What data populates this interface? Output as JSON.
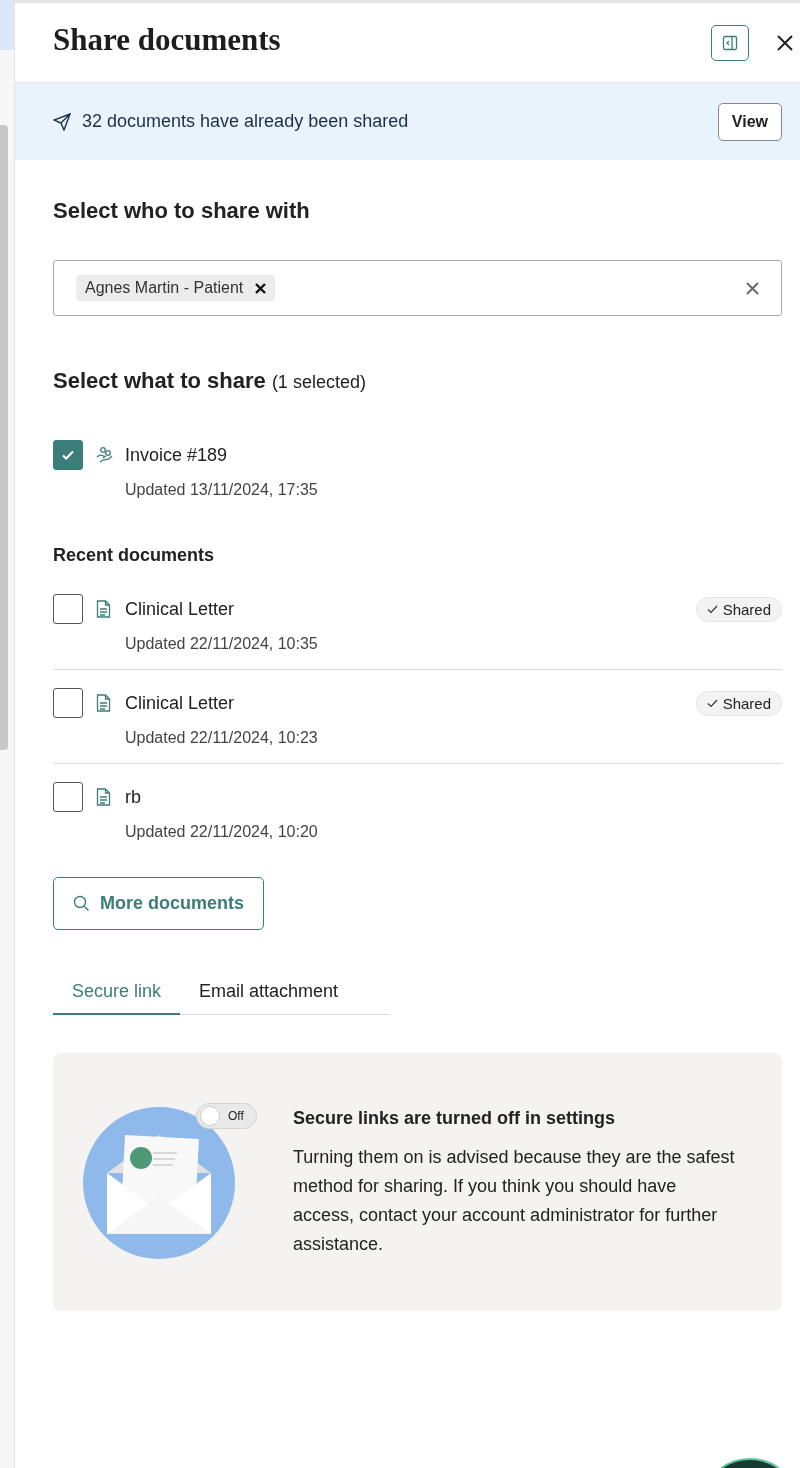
{
  "panel": {
    "title": "Share documents"
  },
  "banner": {
    "text": "32 documents have already been shared",
    "button": "View"
  },
  "recipients": {
    "heading": "Select who to share with",
    "tags": [
      {
        "label": "Agnes Martin - Patient"
      }
    ]
  },
  "documents": {
    "heading": "Select what to share",
    "count": "(1 selected)",
    "selected_items": [
      {
        "kind": "invoice",
        "title": "Invoice #189",
        "updated": "Updated 13/11/2024, 17:35",
        "checked": true
      }
    ],
    "recent_heading": "Recent documents",
    "recent": [
      {
        "kind": "letter",
        "title": "Clinical Letter",
        "updated": "Updated 22/11/2024, 10:35",
        "checked": false,
        "badge": "Shared"
      },
      {
        "kind": "letter",
        "title": "Clinical Letter",
        "updated": "Updated 22/11/2024, 10:23",
        "checked": false,
        "badge": "Shared"
      },
      {
        "kind": "letter",
        "title": "rb",
        "updated": "Updated 22/11/2024, 10:20",
        "checked": false
      }
    ],
    "more_button": "More documents"
  },
  "tabs": [
    {
      "label": "Secure link",
      "selected": true
    },
    {
      "label": "Email attachment",
      "selected": false
    }
  ],
  "notice": {
    "toggle_label": "Off",
    "toggle_on": false,
    "title": "Secure links are turned off in settings",
    "body": "Turning them on is advised because they are the safest method for sharing. If you think you should have access, contact your account administrator for further assistance."
  }
}
